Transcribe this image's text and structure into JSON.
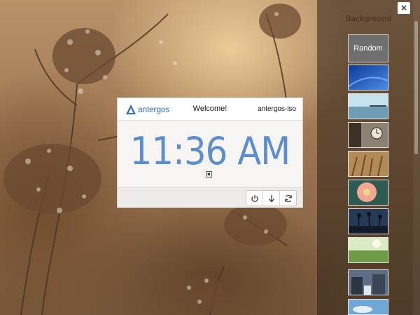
{
  "greeter": {
    "brand": "antergos",
    "welcome": "Welcome!",
    "hostname": "antergos-iso",
    "time": "11:36 AM",
    "actions": [
      {
        "icon": "power-icon"
      },
      {
        "icon": "arrow-down-icon"
      },
      {
        "icon": "refresh-icon"
      }
    ]
  },
  "wallpaper_panel": {
    "title": "Background",
    "random_label": "Random",
    "close_label": "×",
    "thumbnails": [
      {
        "icon": "wallpaper-blue-icon",
        "colors": [
          "#1746a8",
          "#3a78e0"
        ]
      },
      {
        "icon": "wallpaper-sea-icon",
        "colors": [
          "#a9d2e6",
          "#5f8ea8"
        ]
      },
      {
        "icon": "wallpaper-clock-icon",
        "colors": [
          "#d9d2c4",
          "#3b3329"
        ]
      },
      {
        "icon": "wallpaper-grass-icon",
        "colors": [
          "#c9a46a",
          "#8a6a3c"
        ]
      },
      {
        "icon": "wallpaper-flower-icon",
        "colors": [
          "#f0b8a8",
          "#d9654e"
        ]
      },
      {
        "icon": "wallpaper-palms-icon",
        "colors": [
          "#20344e",
          "#5a7895"
        ]
      },
      {
        "icon": "wallpaper-meadow-icon",
        "colors": [
          "#cfe8b8",
          "#6c9a48"
        ]
      },
      {
        "icon": "wallpaper-street-icon",
        "colors": [
          "#6d7f96",
          "#2b3442"
        ]
      },
      {
        "icon": "wallpaper-sky-icon",
        "colors": [
          "#6fa7d6",
          "#dbeaf4"
        ]
      }
    ]
  }
}
